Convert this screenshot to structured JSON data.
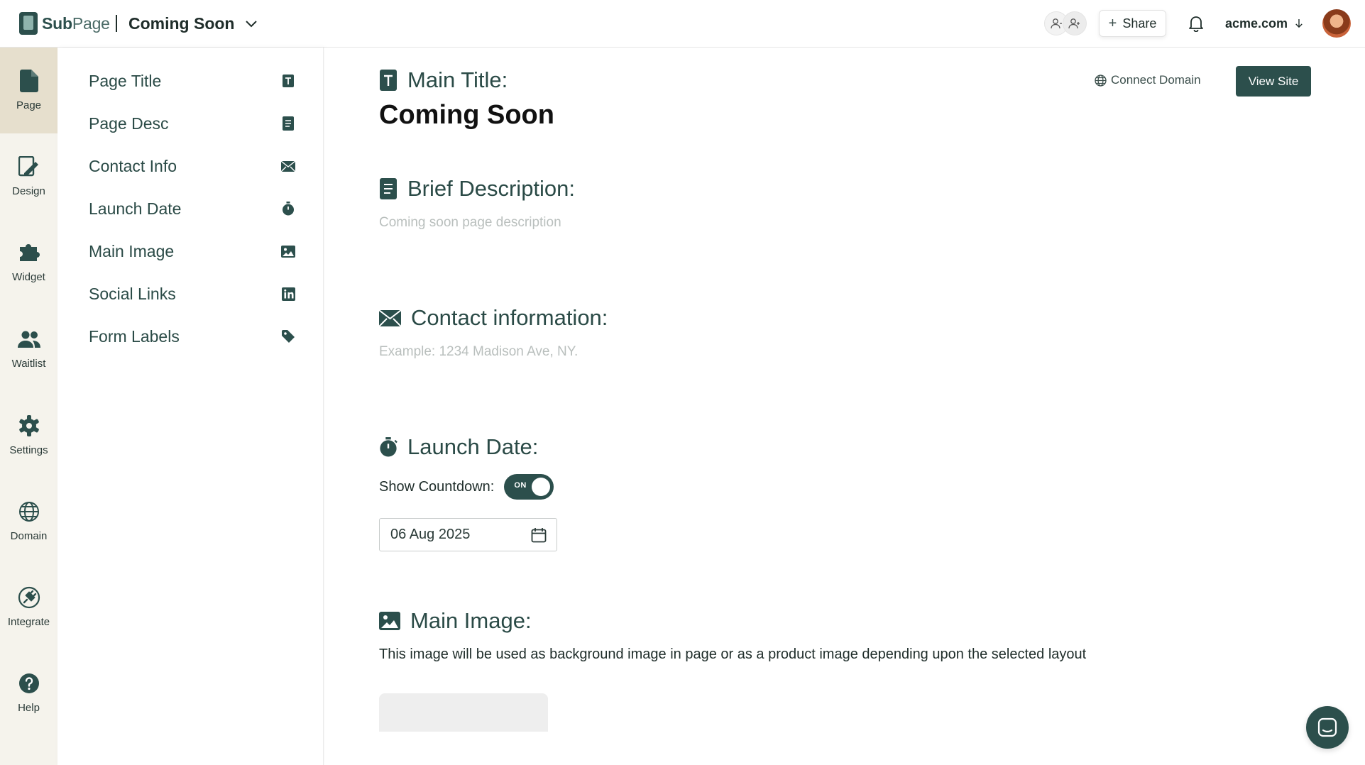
{
  "header": {
    "logo_bold": "Sub",
    "logo_light": "Page",
    "page_name": "Coming Soon",
    "share_label": "Share",
    "account_label": "acme.com"
  },
  "rail": {
    "items": [
      {
        "label": "Page",
        "icon": "page-icon",
        "active": true
      },
      {
        "label": "Design",
        "icon": "design-icon"
      },
      {
        "label": "Widget",
        "icon": "puzzle-icon"
      },
      {
        "label": "Waitlist",
        "icon": "people-icon"
      },
      {
        "label": "Settings",
        "icon": "gear-icon"
      },
      {
        "label": "Domain",
        "icon": "globe-icon"
      },
      {
        "label": "Integrate",
        "icon": "plug-icon"
      },
      {
        "label": "Help",
        "icon": "help-icon"
      }
    ]
  },
  "sections": {
    "items": [
      {
        "label": "Page Title",
        "icon": "text-icon"
      },
      {
        "label": "Page Desc",
        "icon": "document-icon"
      },
      {
        "label": "Contact Info",
        "icon": "envelope-icon"
      },
      {
        "label": "Launch Date",
        "icon": "stopwatch-icon"
      },
      {
        "label": "Main Image",
        "icon": "image-icon"
      },
      {
        "label": "Social Links",
        "icon": "linkedin-icon"
      },
      {
        "label": "Form Labels",
        "icon": "tag-icon"
      }
    ]
  },
  "main": {
    "title_heading": "Main Title:",
    "title_value": "Coming Soon",
    "connect_domain_label": "Connect Domain",
    "view_site_label": "View Site",
    "description_heading": "Brief Description:",
    "description_placeholder": "Coming soon page description",
    "contact_heading": "Contact information:",
    "contact_placeholder": "Example: 1234 Madison Ave, NY.",
    "launch_heading": "Launch Date:",
    "countdown_label": "Show Countdown:",
    "countdown_toggle_text": "ON",
    "launch_date_value": "06 Aug 2025",
    "image_heading": "Main Image:",
    "image_help": "This image will be used as background image in page or as a product image depending upon the selected layout"
  },
  "colors": {
    "accent": "#2c4f4c",
    "rail_bg": "#f5f3ec",
    "rail_active_bg": "#e6dfcd",
    "placeholder": "#b9bfbd"
  }
}
